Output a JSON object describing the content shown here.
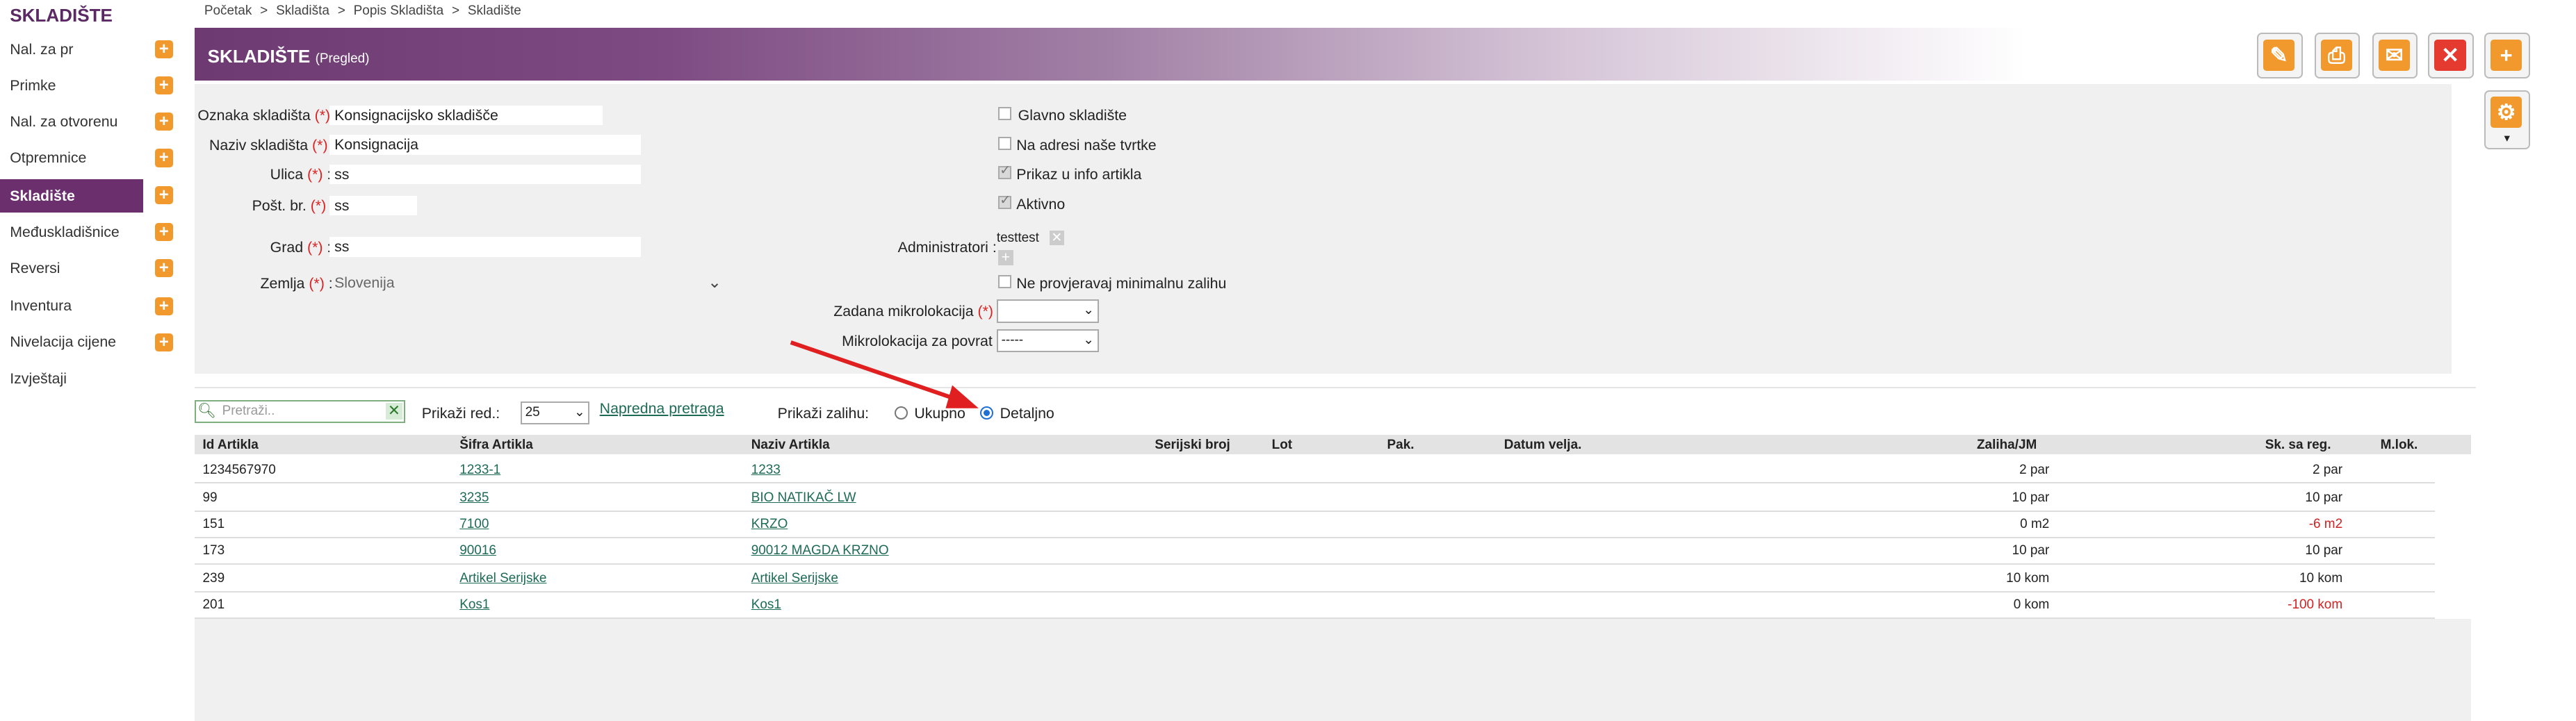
{
  "sidebar": {
    "title": "SKLADIŠTE",
    "items": [
      {
        "label": "Nal. za pr",
        "plus": true
      },
      {
        "label": "Primke",
        "plus": true
      },
      {
        "label": "Nal. za otvorenu",
        "plus": true
      },
      {
        "label": "Otpremnice",
        "plus": true
      },
      {
        "label": "Skladište",
        "plus": true,
        "active": true
      },
      {
        "label": "Međuskladišnice",
        "plus": true
      },
      {
        "label": "Reversi",
        "plus": true
      },
      {
        "label": "Inventura",
        "plus": true
      },
      {
        "label": "Nivelacija cijene",
        "plus": true
      },
      {
        "label": "Izvještaji",
        "plus": false
      }
    ]
  },
  "breadcrumb": [
    "Početak",
    "Skladišta",
    "Popis Skladišta",
    "Skladište"
  ],
  "breadcrumb_sep": ">",
  "header": {
    "title": "SKLADIŠTE",
    "subtitle": "(Pregled)"
  },
  "toolbar": {
    "edit_icon": "pencil-icon",
    "print_icon": "printer-icon",
    "mail_icon": "envelope-icon",
    "delete_icon": "close-icon",
    "add_icon": "plus-icon",
    "settings_icon": "gear-icon",
    "settings_caret": "▾"
  },
  "form": {
    "required": "(*)",
    "oznaka": {
      "label": "Oznaka skladišta",
      "value": "Konsignacijsko skladišče"
    },
    "naziv": {
      "label": "Naziv skladišta",
      "value": "Konsignacija"
    },
    "ulica": {
      "label": "Ulica",
      "value": "ss"
    },
    "post": {
      "label": "Pošt. br.",
      "value": "ss"
    },
    "grad": {
      "label": "Grad",
      "value": "ss"
    },
    "zemlja": {
      "label": "Zemlja",
      "value": "Slovenija"
    },
    "glavno": {
      "label": "Glavno skladište",
      "checked": false
    },
    "na_adresi": {
      "label": "Na adresi naše tvrtke",
      "checked": false
    },
    "prikaz": {
      "label": "Prikaz u info artikla",
      "checked": true
    },
    "aktivno": {
      "label": "Aktivno",
      "checked": true
    },
    "administratori": {
      "label": "Administratori :",
      "value": "testtest"
    },
    "ne_provjeravaj": {
      "label": "Ne provjeravaj minimalnu zalihu",
      "checked": false
    },
    "zadana_mikro": {
      "label": "Zadana mikrolokacija",
      "value": ""
    },
    "mikro_povrat": {
      "label": "Mikrolokacija za povrat :",
      "value": "-----"
    }
  },
  "filter": {
    "search_placeholder": "Pretraži..",
    "prikazi_red_label": "Prikaži red.:",
    "rows_value": "25",
    "advanced_link": "Napredna pretraga",
    "zaliha_label": "Prikaži zalihu:",
    "opt_ukupno": "Ukupno",
    "opt_detaljno": "Detaljno",
    "selected": "Detaljno"
  },
  "table": {
    "columns": [
      "Id Artikla",
      "Šifra Artikla",
      "Naziv Artikla",
      "Serijski broj",
      "Lot",
      "Pak.",
      "Datum velja.",
      "Zaliha/JM",
      "Sk. sa reg.",
      "M.lok."
    ],
    "rows": [
      {
        "id": "1234567970",
        "sifra": "1233-1",
        "naziv": "1233",
        "zaliha": "2 par",
        "sk": "2 par",
        "neg": false
      },
      {
        "id": "99",
        "sifra": "3235",
        "naziv": "BIO NATIKAČ LW",
        "zaliha": "10 par",
        "sk": "10 par",
        "neg": false
      },
      {
        "id": "151",
        "sifra": "7100",
        "naziv": "KRZO",
        "zaliha": "0 m2",
        "sk": "-6 m2",
        "neg": true
      },
      {
        "id": "173",
        "sifra": "90016",
        "naziv": "90012 MAGDA KRZNO",
        "zaliha": "10 par",
        "sk": "10 par",
        "neg": false
      },
      {
        "id": "239",
        "sifra": "Artikel Serijske",
        "naziv": "Artikel Serijske",
        "zaliha": "10 kom",
        "sk": "10 kom",
        "neg": false
      },
      {
        "id": "201",
        "sifra": "Kos1",
        "naziv": "Kos1",
        "zaliha": "0 kom",
        "sk": "-100 kom",
        "neg": true
      }
    ]
  },
  "colors": {
    "brand": "#6b2f6e",
    "accent": "#f2992e",
    "negative": "#d22222",
    "link": "#1d6b55",
    "annotation_arrow": "#e02020"
  }
}
